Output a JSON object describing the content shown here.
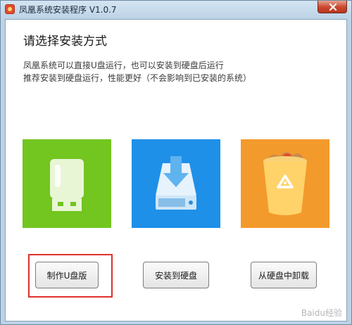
{
  "window": {
    "title": "凤凰系统安装程序 V1.0.7"
  },
  "content": {
    "heading": "请选择安装方式",
    "description_line1": "凤凰系统可以直接U盘运行，也可以安装到硬盘后运行",
    "description_line2": "推荐安装到硬盘运行，性能更好（不会影响到已安装的系统）"
  },
  "options": [
    {
      "icon": "usb-drive-icon",
      "color": "#73c51f",
      "button_label": "制作U盘版",
      "highlighted": true
    },
    {
      "icon": "hard-disk-install-icon",
      "color": "#1e90e8",
      "button_label": "安装到硬盘",
      "highlighted": false
    },
    {
      "icon": "recycle-bin-icon",
      "color": "#f39a2c",
      "button_label": "从硬盘中卸载",
      "highlighted": false
    }
  ],
  "highlight_color": "#e0302f",
  "watermark": "Baidu经验"
}
